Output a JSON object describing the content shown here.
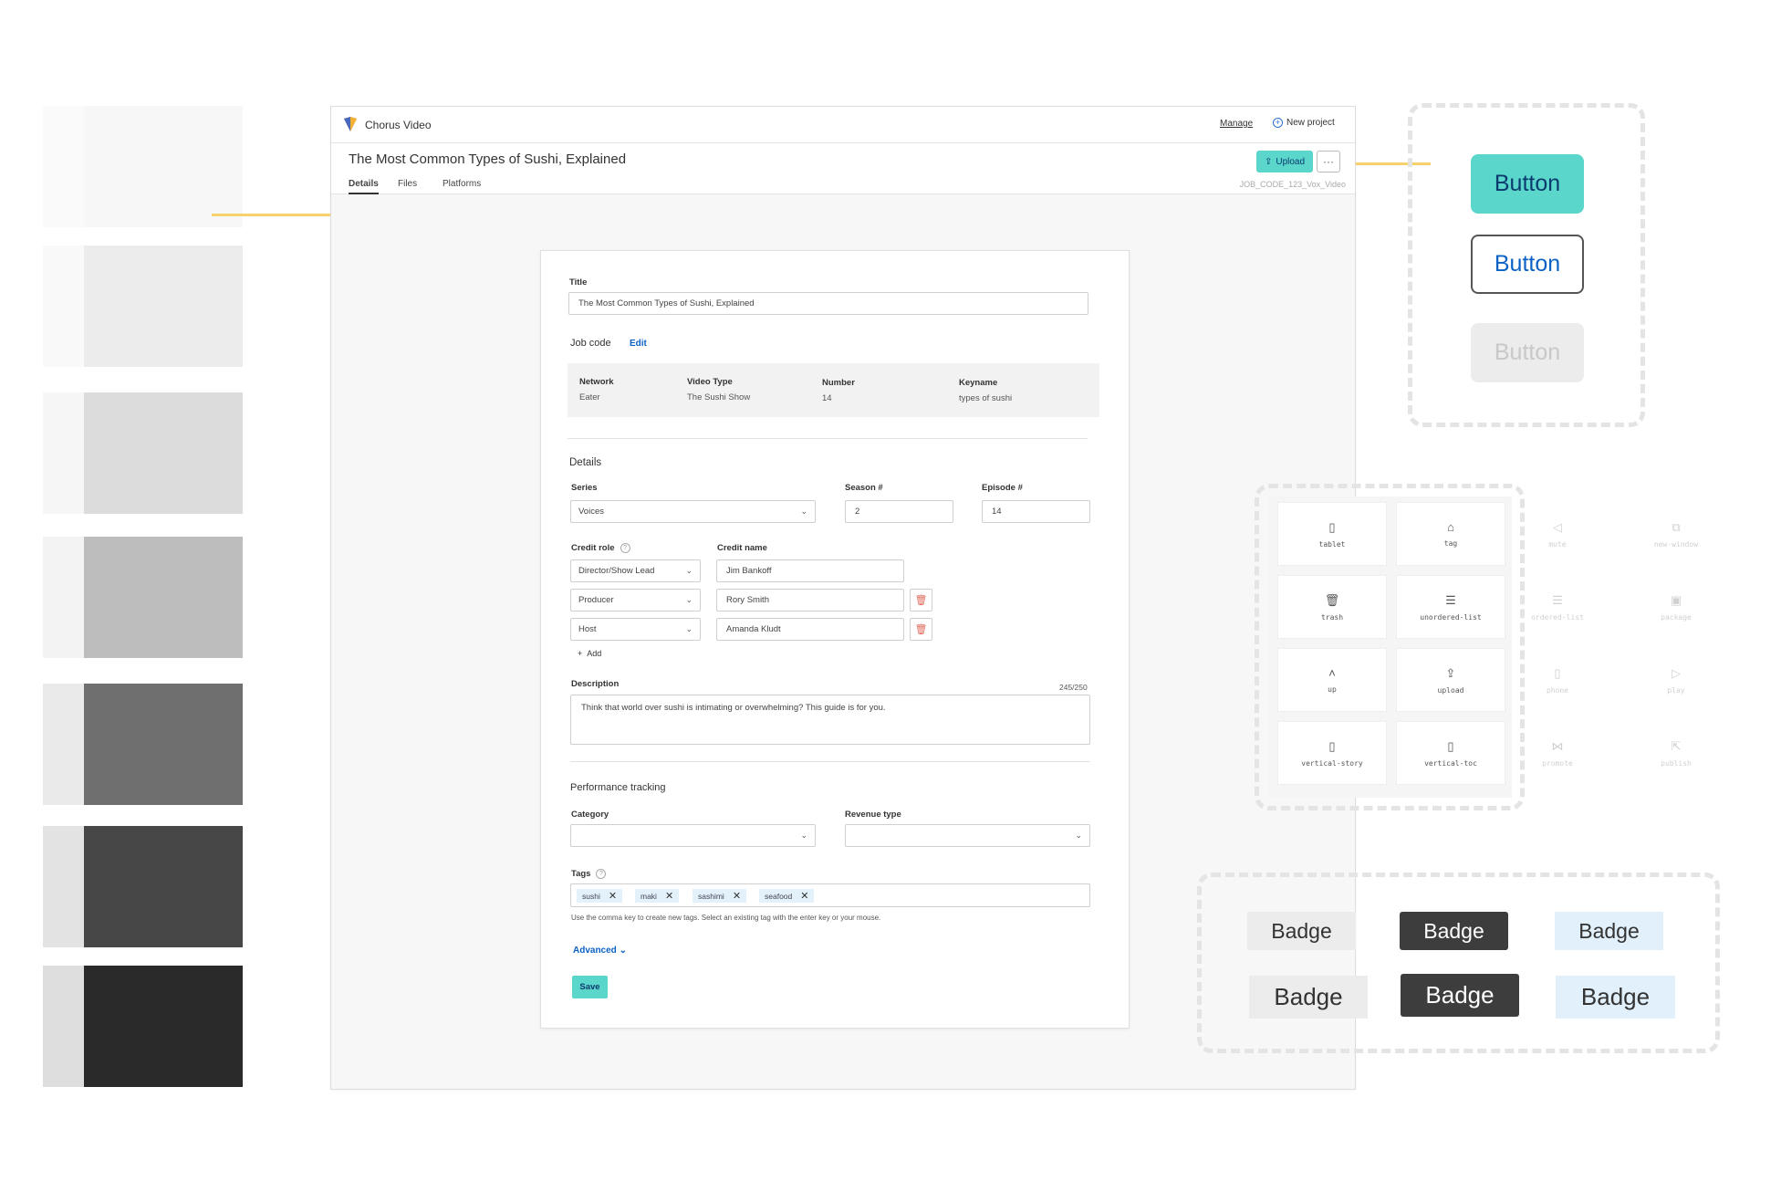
{
  "colors": {
    "accent": "#5ad6cb",
    "link": "#0b62c4",
    "connector": "#f5d26b",
    "danger": "#e26b5b",
    "badge_blue": "#e1f0fb"
  },
  "swatches": [
    {
      "band": "#fafafa",
      "fill": "#f7f7f7"
    },
    {
      "band": "#f9f9f9",
      "fill": "#ececec"
    },
    {
      "band": "#f6f6f6",
      "fill": "#dcdcdc"
    },
    {
      "band": "#f3f3f3",
      "fill": "#bdbdbd"
    },
    {
      "band": "#eaeaea",
      "fill": "#6f6f6f"
    },
    {
      "band": "#e3e3e3",
      "fill": "#474747"
    },
    {
      "band": "#dedede",
      "fill": "#2a2a2a"
    }
  ],
  "app": {
    "brand": "Chorus Video",
    "manage": "Manage",
    "new_project": "New project",
    "page_title": "The Most Common Types of Sushi, Explained",
    "tabs": [
      "Details",
      "Files",
      "Platforms"
    ],
    "upload": "Upload",
    "more": "···",
    "job_code": "JOB_CODE_123_Vox_Video"
  },
  "form": {
    "title_label": "Title",
    "title_value": "The Most Common Types of Sushi, Explained",
    "job_code_label": "Job code",
    "edit": "Edit",
    "job": {
      "network_label": "Network",
      "network": "Eater",
      "video_type_label": "Video Type",
      "video_type": "The Sushi Show",
      "number_label": "Number",
      "number": "14",
      "keyname_label": "Keyname",
      "keyname": "types of sushi"
    },
    "details_heading": "Details",
    "series_label": "Series",
    "series_value": "Voices",
    "season_label": "Season #",
    "season_value": "2",
    "episode_label": "Episode #",
    "episode_value": "14",
    "credit_role_label": "Credit role",
    "credit_name_label": "Credit name",
    "credits": [
      {
        "role": "Director/Show Lead",
        "name": "Jim Bankoff"
      },
      {
        "role": "Producer",
        "name": "Rory Smith"
      },
      {
        "role": "Host",
        "name": "Amanda Kludt"
      }
    ],
    "add": "Add",
    "description_label": "Description",
    "description_count": "245/250",
    "description_value": "Think that world over sushi is intimating or overwhelming? This guide is for you.",
    "performance_heading": "Performance tracking",
    "category_label": "Category",
    "revenue_label": "Revenue type",
    "tags_label": "Tags",
    "tags": [
      "sushi",
      "maki",
      "sashimi",
      "seafood"
    ],
    "tags_help": "Use the comma key to create new tags. Select an existing tag with the enter key or your mouse.",
    "advanced": "Advanced",
    "save": "Save"
  },
  "buttons_demo": [
    "Button",
    "Button",
    "Button"
  ],
  "icons": [
    {
      "name": "tablet",
      "glyph": "▯"
    },
    {
      "name": "tag",
      "glyph": "⌂"
    },
    {
      "name": "trash",
      "glyph": "🗑"
    },
    {
      "name": "unordered-list",
      "glyph": "☰"
    },
    {
      "name": "up",
      "glyph": "˄"
    },
    {
      "name": "upload",
      "glyph": "⇪"
    },
    {
      "name": "vertical-story",
      "glyph": "▯"
    },
    {
      "name": "vertical-toc",
      "glyph": "▯"
    }
  ],
  "icons_ghost": [
    {
      "name": "mute",
      "glyph": "◁"
    },
    {
      "name": "new-window",
      "glyph": "⧉"
    },
    {
      "name": "ordered-list",
      "glyph": "☰"
    },
    {
      "name": "package",
      "glyph": "▣"
    },
    {
      "name": "phone",
      "glyph": "▯"
    },
    {
      "name": "play",
      "glyph": "▷"
    },
    {
      "name": "promote",
      "glyph": "⋈"
    },
    {
      "name": "publish",
      "glyph": "⇱"
    }
  ],
  "badges": [
    "Badge",
    "Badge",
    "Badge",
    "Badge",
    "Badge",
    "Badge"
  ]
}
